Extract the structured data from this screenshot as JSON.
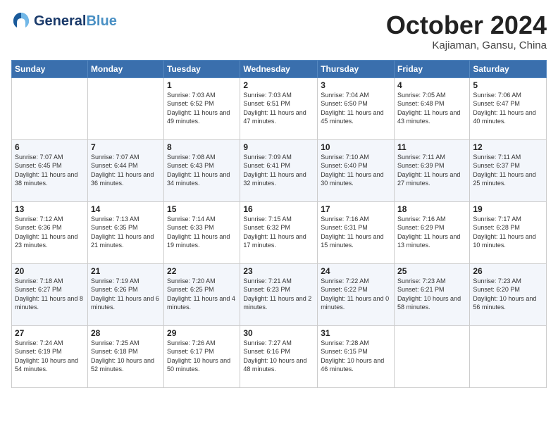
{
  "header": {
    "logo_line1": "General",
    "logo_line2": "Blue",
    "month": "October 2024",
    "location": "Kajiaman, Gansu, China"
  },
  "weekdays": [
    "Sunday",
    "Monday",
    "Tuesday",
    "Wednesday",
    "Thursday",
    "Friday",
    "Saturday"
  ],
  "weeks": [
    [
      null,
      null,
      {
        "day": 1,
        "sunrise": "7:03 AM",
        "sunset": "6:52 PM",
        "daylight": "11 hours and 49 minutes."
      },
      {
        "day": 2,
        "sunrise": "7:03 AM",
        "sunset": "6:51 PM",
        "daylight": "11 hours and 47 minutes."
      },
      {
        "day": 3,
        "sunrise": "7:04 AM",
        "sunset": "6:50 PM",
        "daylight": "11 hours and 45 minutes."
      },
      {
        "day": 4,
        "sunrise": "7:05 AM",
        "sunset": "6:48 PM",
        "daylight": "11 hours and 43 minutes."
      },
      {
        "day": 5,
        "sunrise": "7:06 AM",
        "sunset": "6:47 PM",
        "daylight": "11 hours and 40 minutes."
      }
    ],
    [
      {
        "day": 6,
        "sunrise": "7:07 AM",
        "sunset": "6:45 PM",
        "daylight": "11 hours and 38 minutes."
      },
      {
        "day": 7,
        "sunrise": "7:07 AM",
        "sunset": "6:44 PM",
        "daylight": "11 hours and 36 minutes."
      },
      {
        "day": 8,
        "sunrise": "7:08 AM",
        "sunset": "6:43 PM",
        "daylight": "11 hours and 34 minutes."
      },
      {
        "day": 9,
        "sunrise": "7:09 AM",
        "sunset": "6:41 PM",
        "daylight": "11 hours and 32 minutes."
      },
      {
        "day": 10,
        "sunrise": "7:10 AM",
        "sunset": "6:40 PM",
        "daylight": "11 hours and 30 minutes."
      },
      {
        "day": 11,
        "sunrise": "7:11 AM",
        "sunset": "6:39 PM",
        "daylight": "11 hours and 27 minutes."
      },
      {
        "day": 12,
        "sunrise": "7:11 AM",
        "sunset": "6:37 PM",
        "daylight": "11 hours and 25 minutes."
      }
    ],
    [
      {
        "day": 13,
        "sunrise": "7:12 AM",
        "sunset": "6:36 PM",
        "daylight": "11 hours and 23 minutes."
      },
      {
        "day": 14,
        "sunrise": "7:13 AM",
        "sunset": "6:35 PM",
        "daylight": "11 hours and 21 minutes."
      },
      {
        "day": 15,
        "sunrise": "7:14 AM",
        "sunset": "6:33 PM",
        "daylight": "11 hours and 19 minutes."
      },
      {
        "day": 16,
        "sunrise": "7:15 AM",
        "sunset": "6:32 PM",
        "daylight": "11 hours and 17 minutes."
      },
      {
        "day": 17,
        "sunrise": "7:16 AM",
        "sunset": "6:31 PM",
        "daylight": "11 hours and 15 minutes."
      },
      {
        "day": 18,
        "sunrise": "7:16 AM",
        "sunset": "6:29 PM",
        "daylight": "11 hours and 13 minutes."
      },
      {
        "day": 19,
        "sunrise": "7:17 AM",
        "sunset": "6:28 PM",
        "daylight": "11 hours and 10 minutes."
      }
    ],
    [
      {
        "day": 20,
        "sunrise": "7:18 AM",
        "sunset": "6:27 PM",
        "daylight": "11 hours and 8 minutes."
      },
      {
        "day": 21,
        "sunrise": "7:19 AM",
        "sunset": "6:26 PM",
        "daylight": "11 hours and 6 minutes."
      },
      {
        "day": 22,
        "sunrise": "7:20 AM",
        "sunset": "6:25 PM",
        "daylight": "11 hours and 4 minutes."
      },
      {
        "day": 23,
        "sunrise": "7:21 AM",
        "sunset": "6:23 PM",
        "daylight": "11 hours and 2 minutes."
      },
      {
        "day": 24,
        "sunrise": "7:22 AM",
        "sunset": "6:22 PM",
        "daylight": "11 hours and 0 minutes."
      },
      {
        "day": 25,
        "sunrise": "7:23 AM",
        "sunset": "6:21 PM",
        "daylight": "10 hours and 58 minutes."
      },
      {
        "day": 26,
        "sunrise": "7:23 AM",
        "sunset": "6:20 PM",
        "daylight": "10 hours and 56 minutes."
      }
    ],
    [
      {
        "day": 27,
        "sunrise": "7:24 AM",
        "sunset": "6:19 PM",
        "daylight": "10 hours and 54 minutes."
      },
      {
        "day": 28,
        "sunrise": "7:25 AM",
        "sunset": "6:18 PM",
        "daylight": "10 hours and 52 minutes."
      },
      {
        "day": 29,
        "sunrise": "7:26 AM",
        "sunset": "6:17 PM",
        "daylight": "10 hours and 50 minutes."
      },
      {
        "day": 30,
        "sunrise": "7:27 AM",
        "sunset": "6:16 PM",
        "daylight": "10 hours and 48 minutes."
      },
      {
        "day": 31,
        "sunrise": "7:28 AM",
        "sunset": "6:15 PM",
        "daylight": "10 hours and 46 minutes."
      },
      null,
      null
    ]
  ]
}
